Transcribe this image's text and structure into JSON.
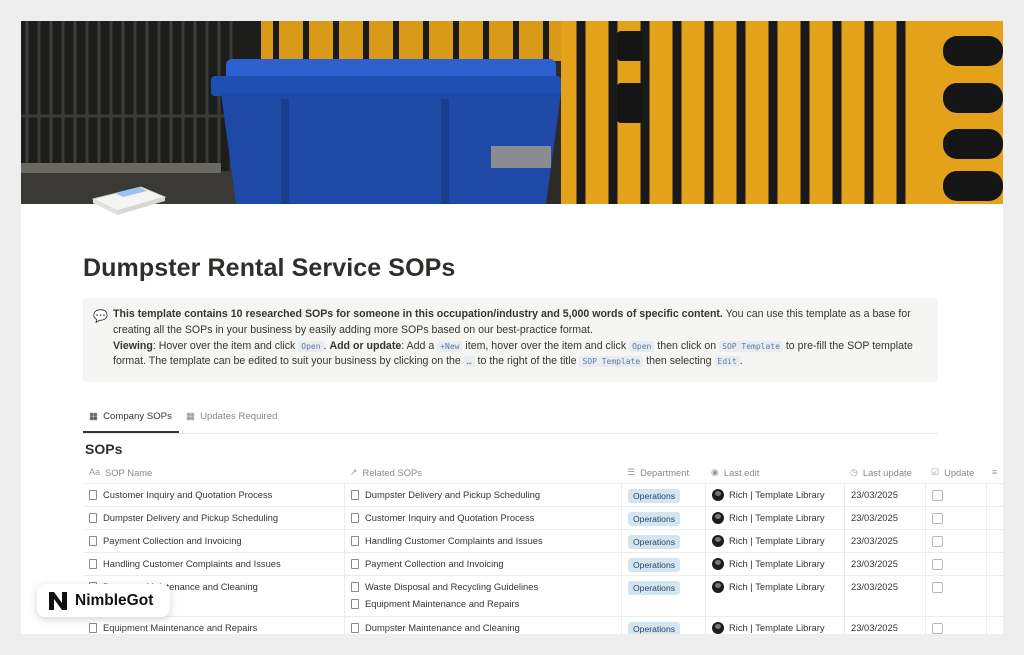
{
  "page": {
    "title": "Dumpster Rental Service SOPs"
  },
  "callout": {
    "icon": "speech-bubble-icon",
    "line1_bold": "This template contains 10 researched SOPs for someone in this occupation/industry and 5,000 words of specific content.",
    "line1_rest": " You can use this template as a base for creating all the SOPs in your business by easily adding more SOPs based on our best-practice format.",
    "viewing_label": "Viewing",
    "viewing_text_1": ": Hover over the item and click ",
    "open_code": "Open",
    "add_update_label": "Add or update",
    "add_text_1": ": Add a ",
    "new_code": "+New",
    "add_text_2": " item, hover over the item and click ",
    "add_text_3": " then click on ",
    "sop_template_code": "SOP Template",
    "add_text_4": " to pre-fill the SOP template format. The template can be edited to suit your business by clicking on the ",
    "dots_code": "…",
    "add_text_5": " to the right of the title ",
    "add_text_6": " then selecting ",
    "edit_code": "Edit",
    "add_text_7": "."
  },
  "tabs": [
    {
      "label": "Company SOPs",
      "active": true
    },
    {
      "label": "Updates Required",
      "active": false
    }
  ],
  "database": {
    "title": "SOPs",
    "columns": {
      "name": "SOP Name",
      "related": "Related SOPs",
      "department": "Department",
      "last_edit": "Last edit",
      "last_update": "Last update",
      "update": "Update"
    },
    "rows": [
      {
        "name": "Customer Inquiry and Quotation Process",
        "related": [
          "Dumpster Delivery and Pickup Scheduling"
        ],
        "department": "Operations",
        "editor": "Rich | Template Library",
        "date": "23/03/2025"
      },
      {
        "name": "Dumpster Delivery and Pickup Scheduling",
        "related": [
          "Customer Inquiry and Quotation Process"
        ],
        "department": "Operations",
        "editor": "Rich | Template Library",
        "date": "23/03/2025"
      },
      {
        "name": "Payment Collection and Invoicing",
        "related": [
          "Handling Customer Complaints and Issues"
        ],
        "department": "Operations",
        "editor": "Rich | Template Library",
        "date": "23/03/2025"
      },
      {
        "name": "Handling Customer Complaints and Issues",
        "related": [
          "Payment Collection and Invoicing"
        ],
        "department": "Operations",
        "editor": "Rich | Template Library",
        "date": "23/03/2025"
      },
      {
        "name": "Dumpster Maintenance and Cleaning",
        "related": [
          "Waste Disposal and Recycling Guidelines",
          "Equipment Maintenance and Repairs"
        ],
        "department": "Operations",
        "editor": "Rich | Template Library",
        "date": "23/03/2025"
      },
      {
        "name": "Equipment Maintenance and Repairs",
        "related": [
          "Dumpster Maintenance and Cleaning"
        ],
        "department": "Operations",
        "editor": "Rich | Template Library",
        "date": "23/03/2025"
      }
    ]
  },
  "watermark": {
    "text": "NimbleGot"
  },
  "colors": {
    "badge_bg": "#d3e5ef",
    "badge_text": "#28456c",
    "cover_bin": "#1f4fb0",
    "cover_panel": "#e8a31c"
  }
}
